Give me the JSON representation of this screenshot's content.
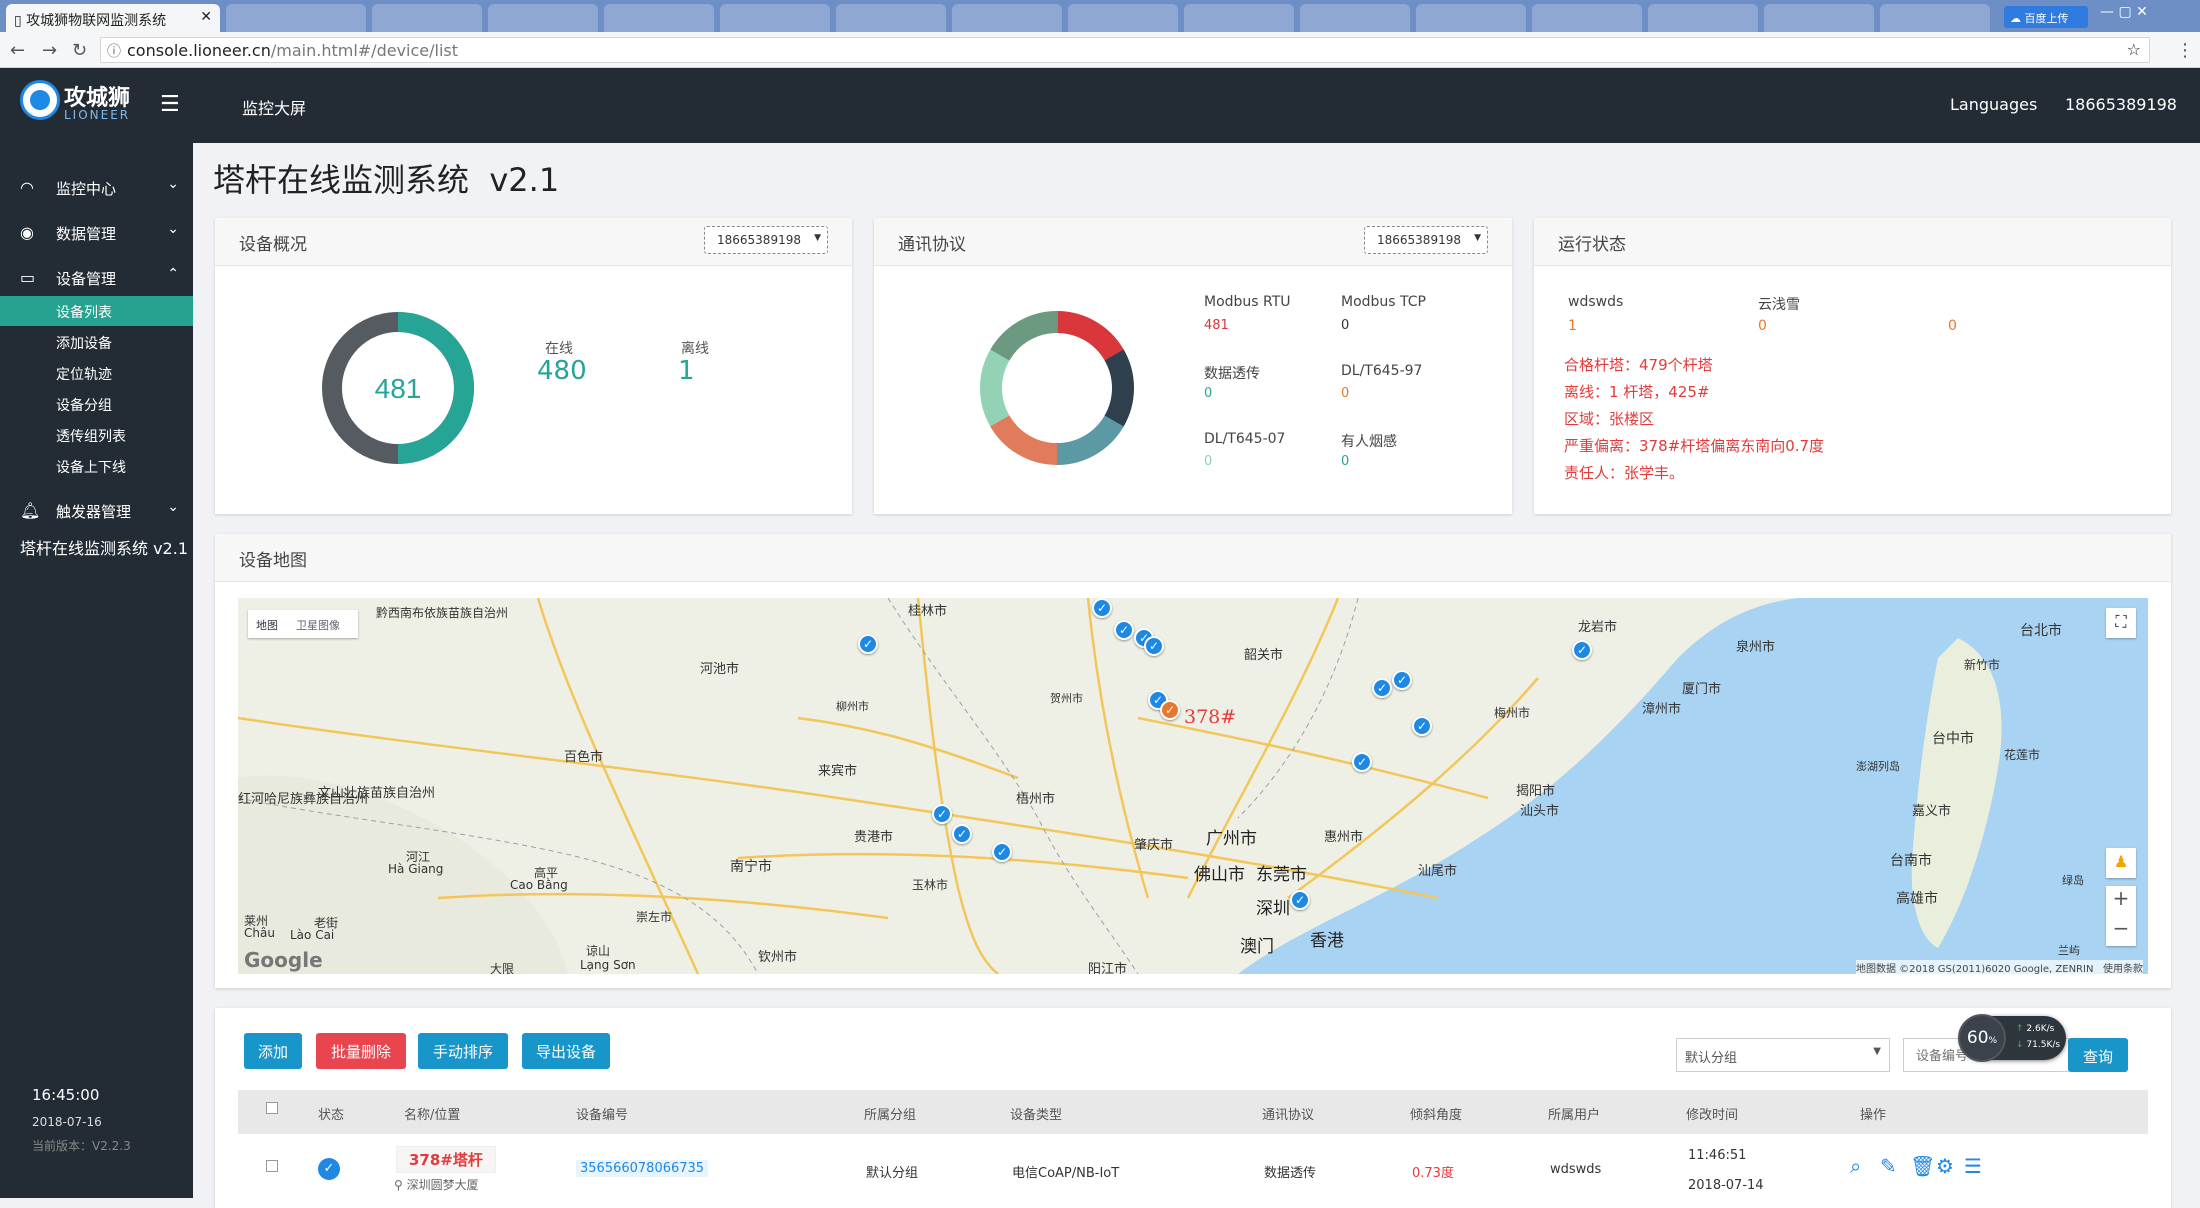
{
  "browser": {
    "active_tab_title": "攻城狮物联网监测系统",
    "url_host": "console.lioneer.cn",
    "url_path": "/main.html#/device/list",
    "badge": "百度上传"
  },
  "header": {
    "logo_text": "攻城狮",
    "logo_sub": "LIONEER",
    "nav_link": "监控大屏",
    "languages": "Languages",
    "user": "18665389198"
  },
  "sidebar": {
    "items": [
      {
        "label": "监控中心"
      },
      {
        "label": "数据管理"
      },
      {
        "label": "设备管理"
      },
      {
        "label": "触发器管理"
      }
    ],
    "sub_items": [
      "设备列表",
      "添加设备",
      "定位轨迹",
      "设备分组",
      "透传组列表",
      "设备上下线"
    ],
    "app_name": "塔杆在线监测系统 v2.1",
    "time": "16:45:00",
    "date": "2018-07-16",
    "version": "当前版本：V2.2.3"
  },
  "page_title": "塔杆在线监测系统  v2.1",
  "overview": {
    "title": "设备概况",
    "select": "18665389198",
    "total": "481",
    "online_label": "在线",
    "online_value": "480",
    "offline_label": "离线",
    "offline_value": "1",
    "online_fraction": 0.998,
    "colors": {
      "online": "#26a596",
      "offline": "#555b61"
    }
  },
  "protocol": {
    "title": "通讯协议",
    "select": "18665389198",
    "items": [
      {
        "label": "Modbus RTU",
        "value": "481",
        "color": "#d9373b"
      },
      {
        "label": "Modbus TCP",
        "value": "0",
        "color": "#333333"
      },
      {
        "label": "数据透传",
        "value": "0",
        "color": "#26a596"
      },
      {
        "label": "DL/T645-97",
        "value": "0",
        "color": "#e8772e"
      },
      {
        "label": "DL/T645-07",
        "value": "0",
        "color": "#8fd4b0"
      },
      {
        "label": "有人烟感",
        "value": "0",
        "color": "#26a596"
      }
    ]
  },
  "status": {
    "title": "运行状态",
    "cols": [
      {
        "label": "wdswds",
        "value": "1"
      },
      {
        "label": "云浅雪",
        "value": "0"
      },
      {
        "label": "",
        "value": "0"
      }
    ],
    "lines": [
      "合格杆塔：479个杆塔",
      "离线：1 杆塔，425#",
      "区域：张楼区",
      "严重偏离：378#杆塔偏离东南向0.7度",
      "责任人：张学丰。"
    ]
  },
  "map": {
    "title": "设备地图",
    "type_map": "地图",
    "type_satellite": "卫星图像",
    "marker_label": "378#",
    "google": "Google",
    "attribution": "地图数据 ©2018 GS(2011)6020 Google, ZENRIN   使用条款",
    "cities": [
      "黔西南布依族苗族自治州",
      "河池市",
      "桂林市",
      "柳州市",
      "贺州市",
      "韶关市",
      "龙岩市",
      "泉州市",
      "台北市",
      "新竹市",
      "百色市",
      "来宾市",
      "梧州市",
      "梅州市",
      "厦门市",
      "漳州市",
      "台中市",
      "花莲市",
      "文山壮族苗族自治州",
      "红河哈尼族彝族自治州",
      "贵港市",
      "肇庆市",
      "广州市",
      "惠州市",
      "揭阳市",
      "汕头市",
      "澎湖列岛",
      "嘉义市",
      "南宁市",
      "玉林市",
      "佛山市",
      "东莞市",
      "汕尾市",
      "台南市",
      "高雄市",
      "河江",
      "Hà Giang",
      "高平",
      "Cao Bằng",
      "崇左市",
      "深圳",
      "澳门",
      "香港",
      "老街",
      "Lào Cai",
      "钦州市",
      "阳江市",
      "大限",
      "谅山",
      "Lạng Sơn",
      "绿岛",
      "兰屿",
      "莱州",
      "Châu"
    ]
  },
  "toolbar": {
    "add": "添加",
    "batch_delete": "批量删除",
    "manual_sort": "手动排序",
    "export": "导出设备",
    "group_select": "默认分组",
    "search_placeholder": "设备编号",
    "query": "查询",
    "speed": "60",
    "speed_unit": "%",
    "up_rate": "2.6K/s",
    "down_rate": "71.5K/s"
  },
  "table": {
    "headers": [
      "状态",
      "名称/位置",
      "设备编号",
      "所属分组",
      "设备类型",
      "通讯协议",
      "倾斜角度",
      "所属用户",
      "修改时间",
      "操作"
    ],
    "rows": [
      {
        "name": "378#塔杆",
        "location": "深圳圆梦大厦",
        "device_id": "356566078066735",
        "group": "默认分组",
        "type": "电信CoAP/NB-IoT",
        "protocol": "数据透传",
        "tilt": "0.73度",
        "user": "wdswds",
        "time": "11:46:51",
        "date": "2018-07-14"
      }
    ]
  }
}
